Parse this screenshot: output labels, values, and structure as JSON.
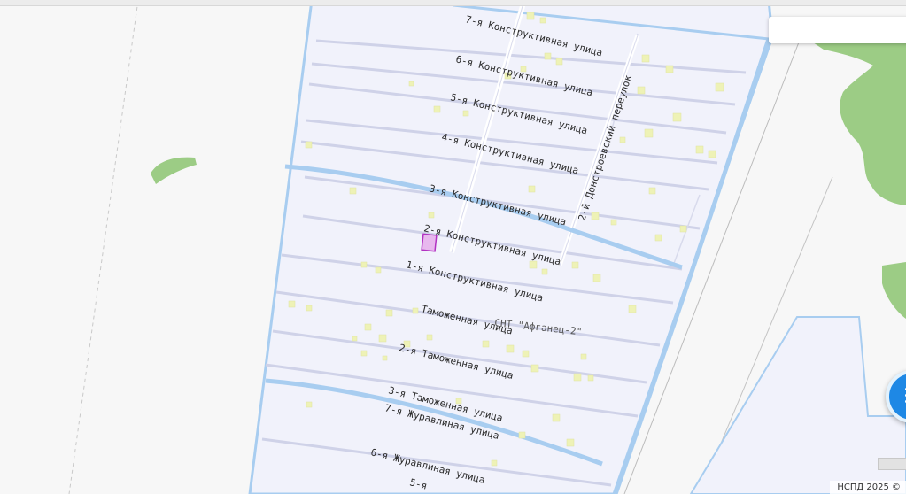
{
  "map": {
    "streets": [
      {
        "id": "k7",
        "label": "7-я Конструктивная улица"
      },
      {
        "id": "k6",
        "label": "6-я Конструктивная улица"
      },
      {
        "id": "k5",
        "label": "5-я Конструктивная улица"
      },
      {
        "id": "k4",
        "label": "4-я Конструктивная улица"
      },
      {
        "id": "k3",
        "label": "3-я Конструктивная улица"
      },
      {
        "id": "k2",
        "label": "2-я Конструктивная улица"
      },
      {
        "id": "k1",
        "label": "1-я Конструктивная улица"
      },
      {
        "id": "t1",
        "label": "Таможенная улица"
      },
      {
        "id": "t2",
        "label": "2-я Таможенная улица"
      },
      {
        "id": "t3",
        "label": "3-я Таможенная улица"
      },
      {
        "id": "z7",
        "label": "7-я Журавлиная улица"
      },
      {
        "id": "z6",
        "label": "6-я Журавлиная улица"
      },
      {
        "id": "z5",
        "label": "5-я"
      },
      {
        "id": "lane",
        "label": "2-й Донстроевский переулок"
      }
    ],
    "settlement_label": "СНТ \"Афганец-2\"",
    "attribution": "НСПД 2025 ©",
    "colors": {
      "background": "#f7f7f7",
      "territory_fill": "#f1f2fb",
      "canal": "#a8cdf0",
      "parcel_outline": "#cfd2e8",
      "building": "#eef2b6",
      "vegetation": "#9ccc85",
      "selected_parcel": "#e8b8ee",
      "selected_outline": "#b232c2",
      "menu_button": "#1e88e5"
    },
    "icons": {
      "menu_button": "list-menu-icon"
    }
  }
}
